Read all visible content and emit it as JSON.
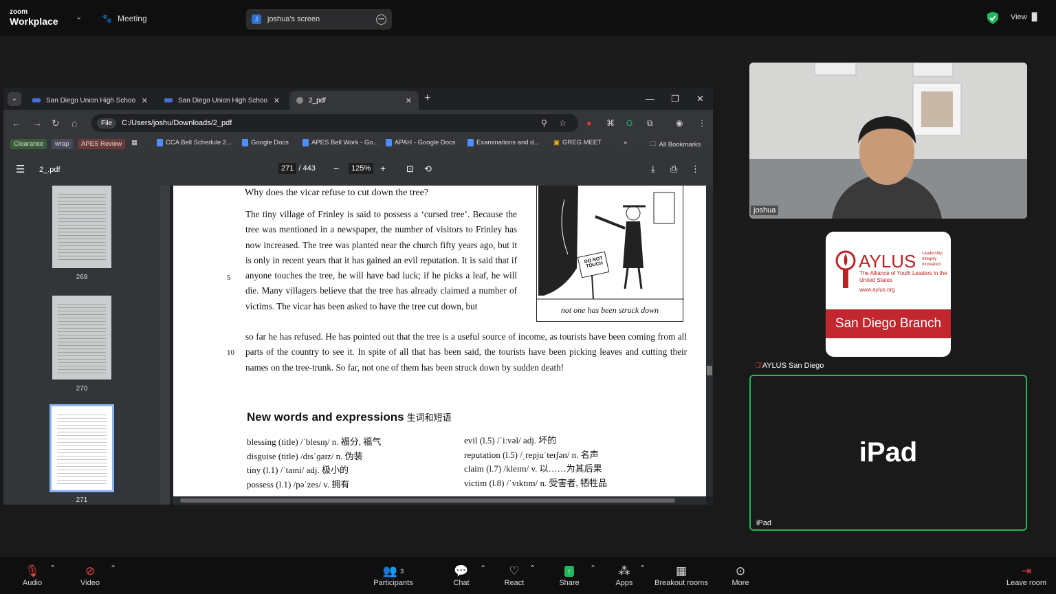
{
  "zoom": {
    "logo_top": "zoom",
    "logo_bottom": "Workplace",
    "meeting_label": "Meeting",
    "share_badge": "J",
    "share_title": "joshua's screen",
    "view_label": "View",
    "toolbar": {
      "audio": "Audio",
      "video": "Video",
      "participants": "Participants",
      "participants_count": "3",
      "chat": "Chat",
      "react": "React",
      "share": "Share",
      "apps": "Apps",
      "breakout": "Breakout rooms",
      "more": "More",
      "leave": "Leave room"
    }
  },
  "browser": {
    "tabs": [
      {
        "title": "San Diego Union High Schoo",
        "close": "✕"
      },
      {
        "title": "San Diego Union High Schoo",
        "close": "✕"
      },
      {
        "title": "2_pdf",
        "close": "✕"
      }
    ],
    "file_chip": "File",
    "url": "C:/Users/joshu/Downloads/2_pdf",
    "bookmarks": [
      "Clearance",
      "wrap",
      "APES Review",
      "CCA Bell Schedule 2...",
      "Google Docs",
      "APES Bell Work - Go...",
      "APAH - Google Docs",
      "Examinations and d...",
      "GREG MEET"
    ],
    "all_bookmarks": "All Bookmarks"
  },
  "pdf": {
    "title": "2_.pdf",
    "page_current": "271",
    "page_total": "/ 443",
    "zoom": "125%",
    "thumbnails": [
      "269",
      "270",
      "271"
    ],
    "question": "Why does the vicar refuse to cut down the tree?",
    "para1": "The tiny village of Frinley is said to possess a ‘cursed tree’. Because the tree was mentioned in a newspaper, the number of visitors to Frinley has now increased. The tree was planted near the church fifty years ago, but it is only in recent years that it has gained an evil reputation. It is said that if anyone touches the tree, he will have bad luck; if he picks a leaf, he will die. Many villagers believe that the tree has already claimed a number of victims. The vicar has been asked to have the tree cut down, but",
    "para2": "so far he has refused. He has pointed out that the tree is a useful source of income, as tourists have been coming from all parts of the country to see it. In spite of all that has been said, the tourists have been picking leaves and cutting their names on the tree-trunk. So far, not one of them has been struck down by sudden death!",
    "line_5": "5",
    "line_10": "10",
    "cartoon_sign": "DO NOT TOUCH",
    "cartoon_caption": "not one has been struck down",
    "heading": "New words and expressions",
    "heading_cn": "生词和短语",
    "vocab_left": [
      "blessing (title) /ˈblesɪŋ/ n. 福分, 福气",
      "disguise (title) /dɪsˈɡaɪz/ n. 伪装",
      "tiny (l.1) /ˈtaɪni/ adj. 极小的",
      "possess (l.1) /pəˈzes/ v. 拥有"
    ],
    "vocab_right": [
      "evil (l.5) /ˈiːvəl/ adj. 坏的",
      "reputation (l.5) /ˌrepjuˈteɪʃən/ n. 名声",
      "claim (l.7) /kleɪm/ v. 以……为其后果",
      "victim (l.8) /ˈvɪktɪm/ n. 受害者, 牺牲品"
    ]
  },
  "participants": {
    "joshua": "joshua",
    "aylus_tile": "AYLUS San Diego",
    "aylus_name": "AYLUS",
    "aylus_tagline": "Leadership Integrity Innovation",
    "aylus_full": "The Alliance of Youth Leaders in the United States",
    "aylus_url": "www.aylus.org",
    "aylus_branch": "San Diego Branch",
    "ipad_big": "iPad",
    "ipad_label": "iPad"
  },
  "colors": {
    "accent_green": "#1fb85a",
    "aylus_red": "#c2262e",
    "zoom_bg": "#1a1a1a"
  }
}
